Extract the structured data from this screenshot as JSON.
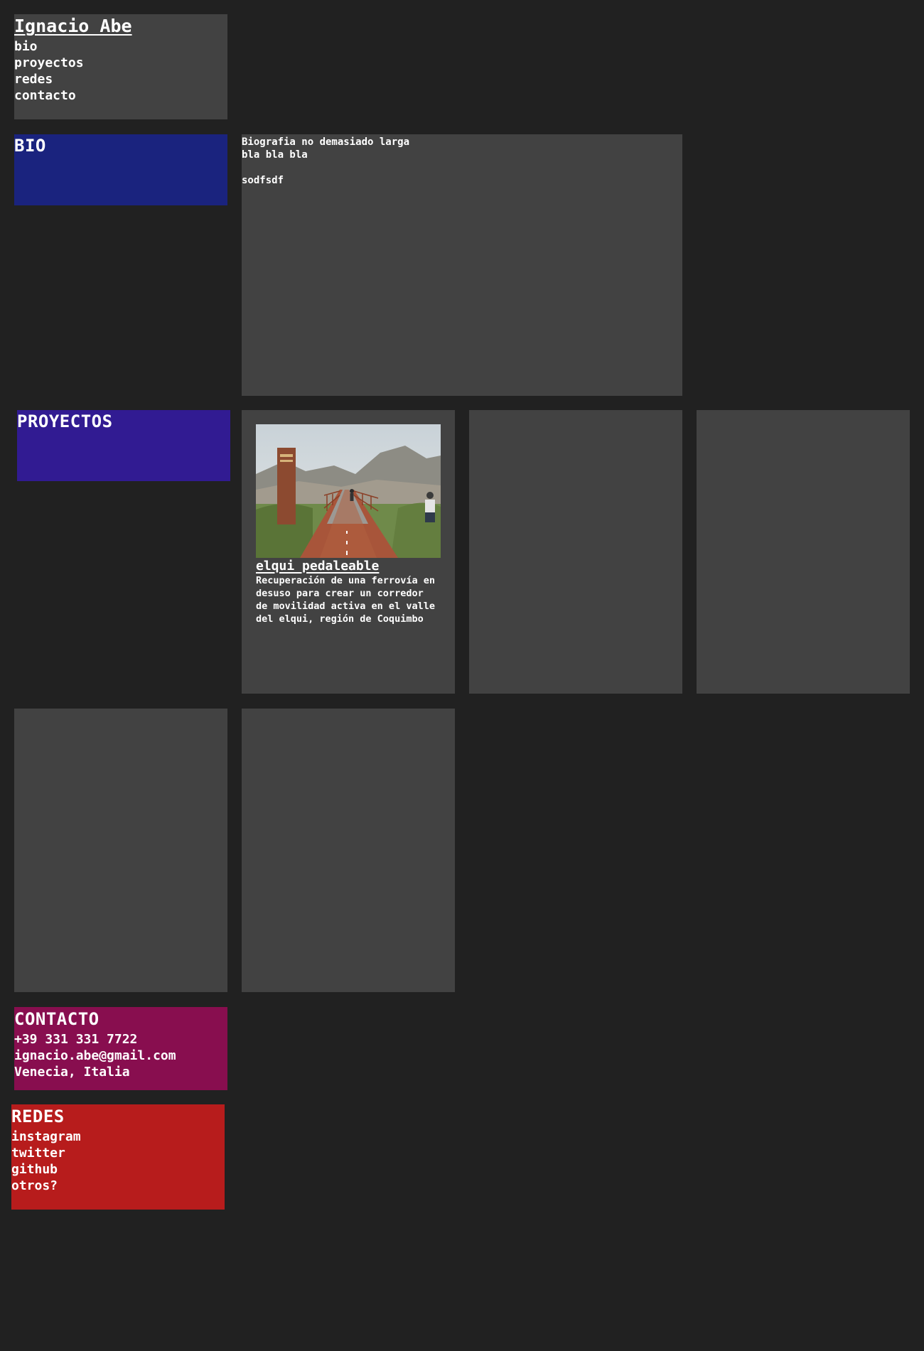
{
  "header": {
    "site_title": "Ignacio Abe",
    "nav": [
      {
        "label": "bio"
      },
      {
        "label": "proyectos"
      },
      {
        "label": "redes"
      },
      {
        "label": "contacto"
      }
    ]
  },
  "bio": {
    "heading": "BIO",
    "text": "Biografia no demasiado larga\nbla bla bla\n\nsodfsdf"
  },
  "projects": {
    "heading": "PROYECTOS",
    "items": [
      {
        "title": "elqui pedaleable",
        "description": "Recuperación de una ferrovía en desuso para crear un corredor de movilidad activa en el valle del elqui, región de Coquimbo"
      }
    ]
  },
  "contact": {
    "heading": "CONTACTO",
    "phone": "+39 331 331 7722",
    "email": "ignacio.abe@gmail.com",
    "location": "Venecia, Italia"
  },
  "social": {
    "heading": "REDES",
    "links": [
      {
        "label": "instagram"
      },
      {
        "label": "twitter"
      },
      {
        "label": "github"
      },
      {
        "label": "otros?"
      }
    ]
  },
  "colors": {
    "background": "#212121",
    "card": "#424242",
    "bio_accent": "#1a237e",
    "projects_accent": "#311b92",
    "contact_accent": "#880e4f",
    "social_accent": "#b71c1c"
  }
}
